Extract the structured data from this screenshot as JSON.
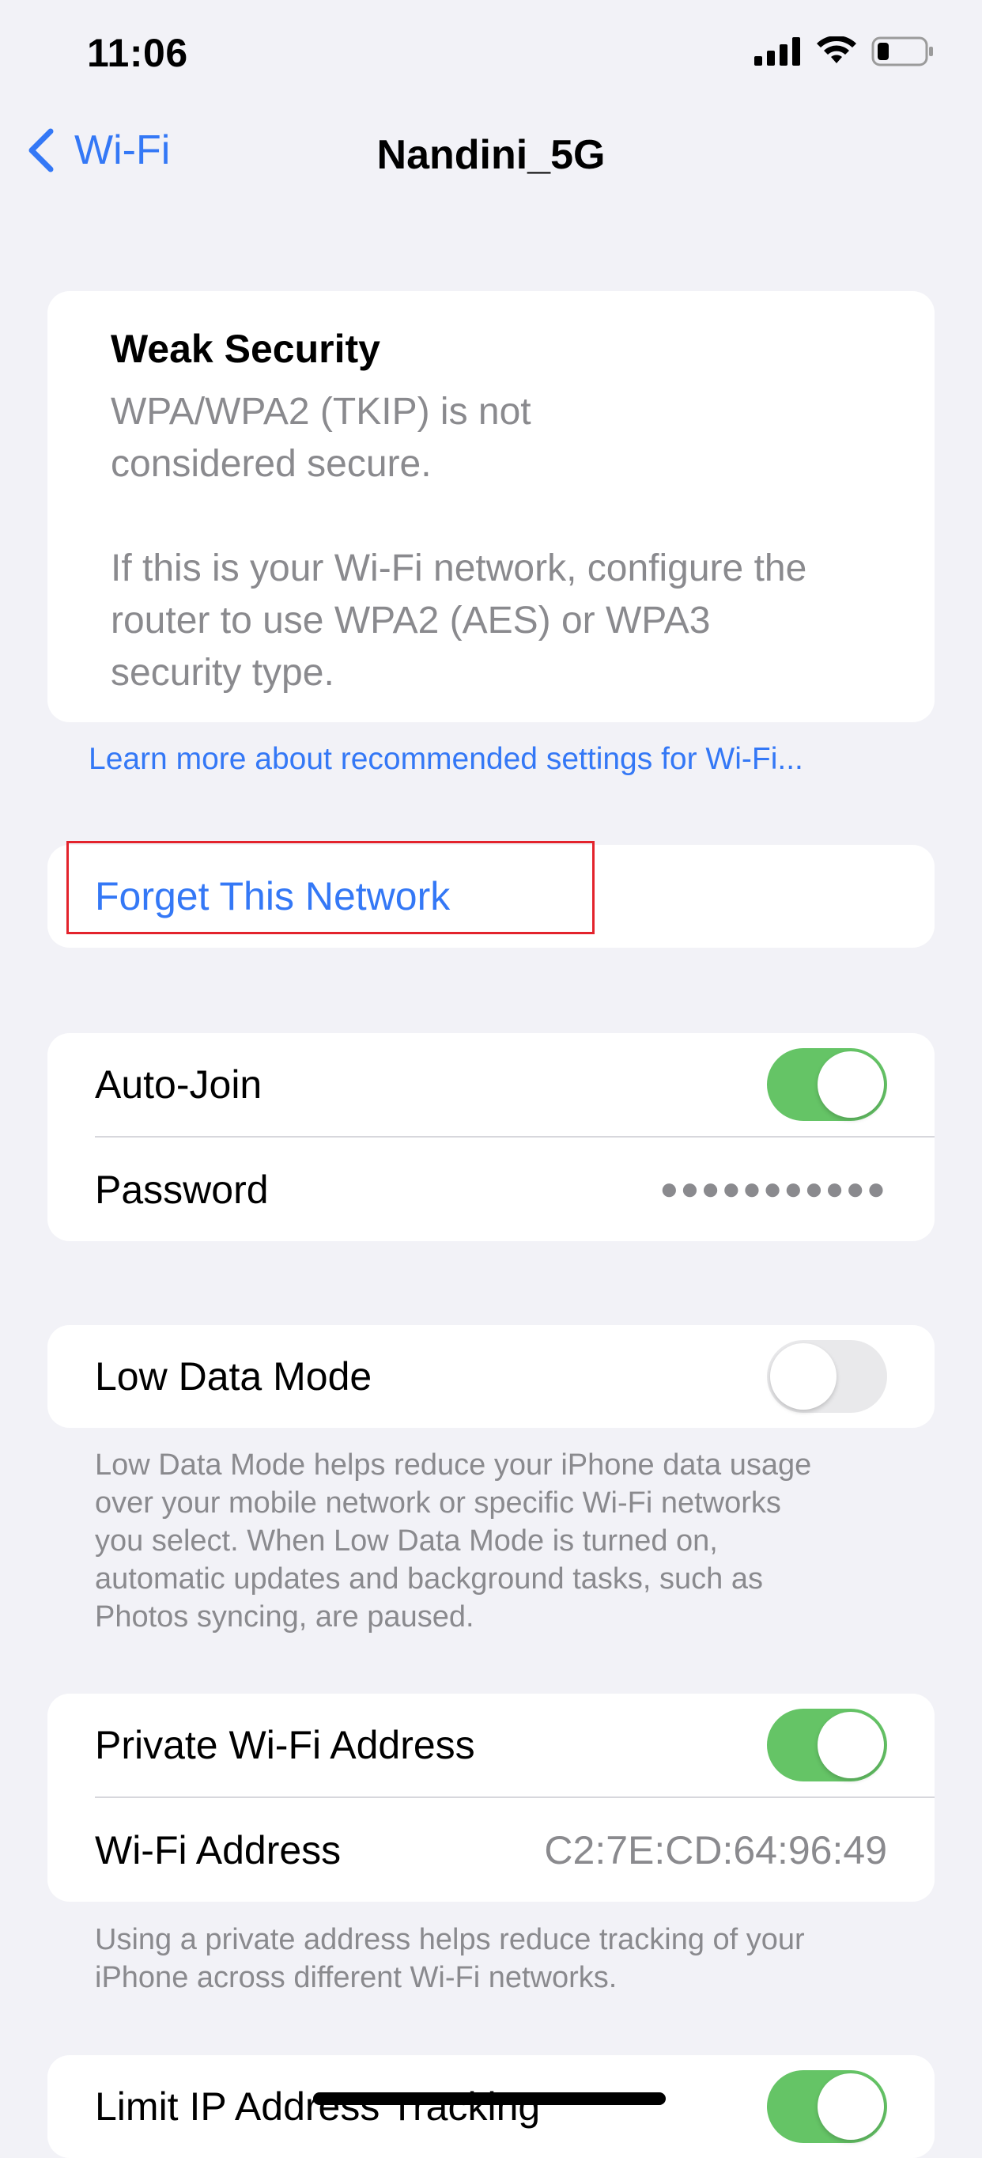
{
  "status_bar": {
    "time": "11:06",
    "signal_icon": "cellular-signal-icon",
    "wifi_icon": "wifi-icon",
    "battery_icon": "battery-icon"
  },
  "nav": {
    "back_label": "Wi-Fi",
    "back_icon": "chevron-left-icon",
    "title": "Nandini_5G"
  },
  "weak_security": {
    "title": "Weak Security",
    "line1": "WPA/WPA2 (TKIP) is not",
    "line2": "considered secure.",
    "line3": "If this is your Wi-Fi network, configure the",
    "line4": "router to use WPA2 (AES) or WPA3",
    "line5": "security type."
  },
  "learn_more": "Learn more about recommended settings for Wi-Fi...",
  "forget": {
    "label": "Forget This Network"
  },
  "group1": {
    "auto_join": {
      "label": "Auto-Join",
      "on": true
    },
    "password": {
      "label": "Password",
      "value": "●●●●●●●●●●●"
    }
  },
  "low_data": {
    "label": "Low Data Mode",
    "on": false,
    "footnote_lines": [
      "Low Data Mode helps reduce your iPhone data usage",
      "over your mobile network or specific Wi-Fi networks",
      "you select. When Low Data Mode is turned on,",
      "automatic updates and background tasks, such as",
      "Photos syncing, are paused."
    ]
  },
  "private": {
    "private_address": {
      "label": "Private Wi-Fi Address",
      "on": true
    },
    "wifi_address": {
      "label": "Wi-Fi Address",
      "value": "C2:7E:CD:64:96:49"
    },
    "footnote_lines": [
      "Using a private address helps reduce tracking of your",
      "iPhone across different Wi-Fi networks."
    ]
  },
  "limit_ip": {
    "label": "Limit IP Address Tracking",
    "on": true
  },
  "colors": {
    "accent": "#3478f6",
    "toggle_on": "#65c466",
    "highlight": "#e3232c"
  }
}
